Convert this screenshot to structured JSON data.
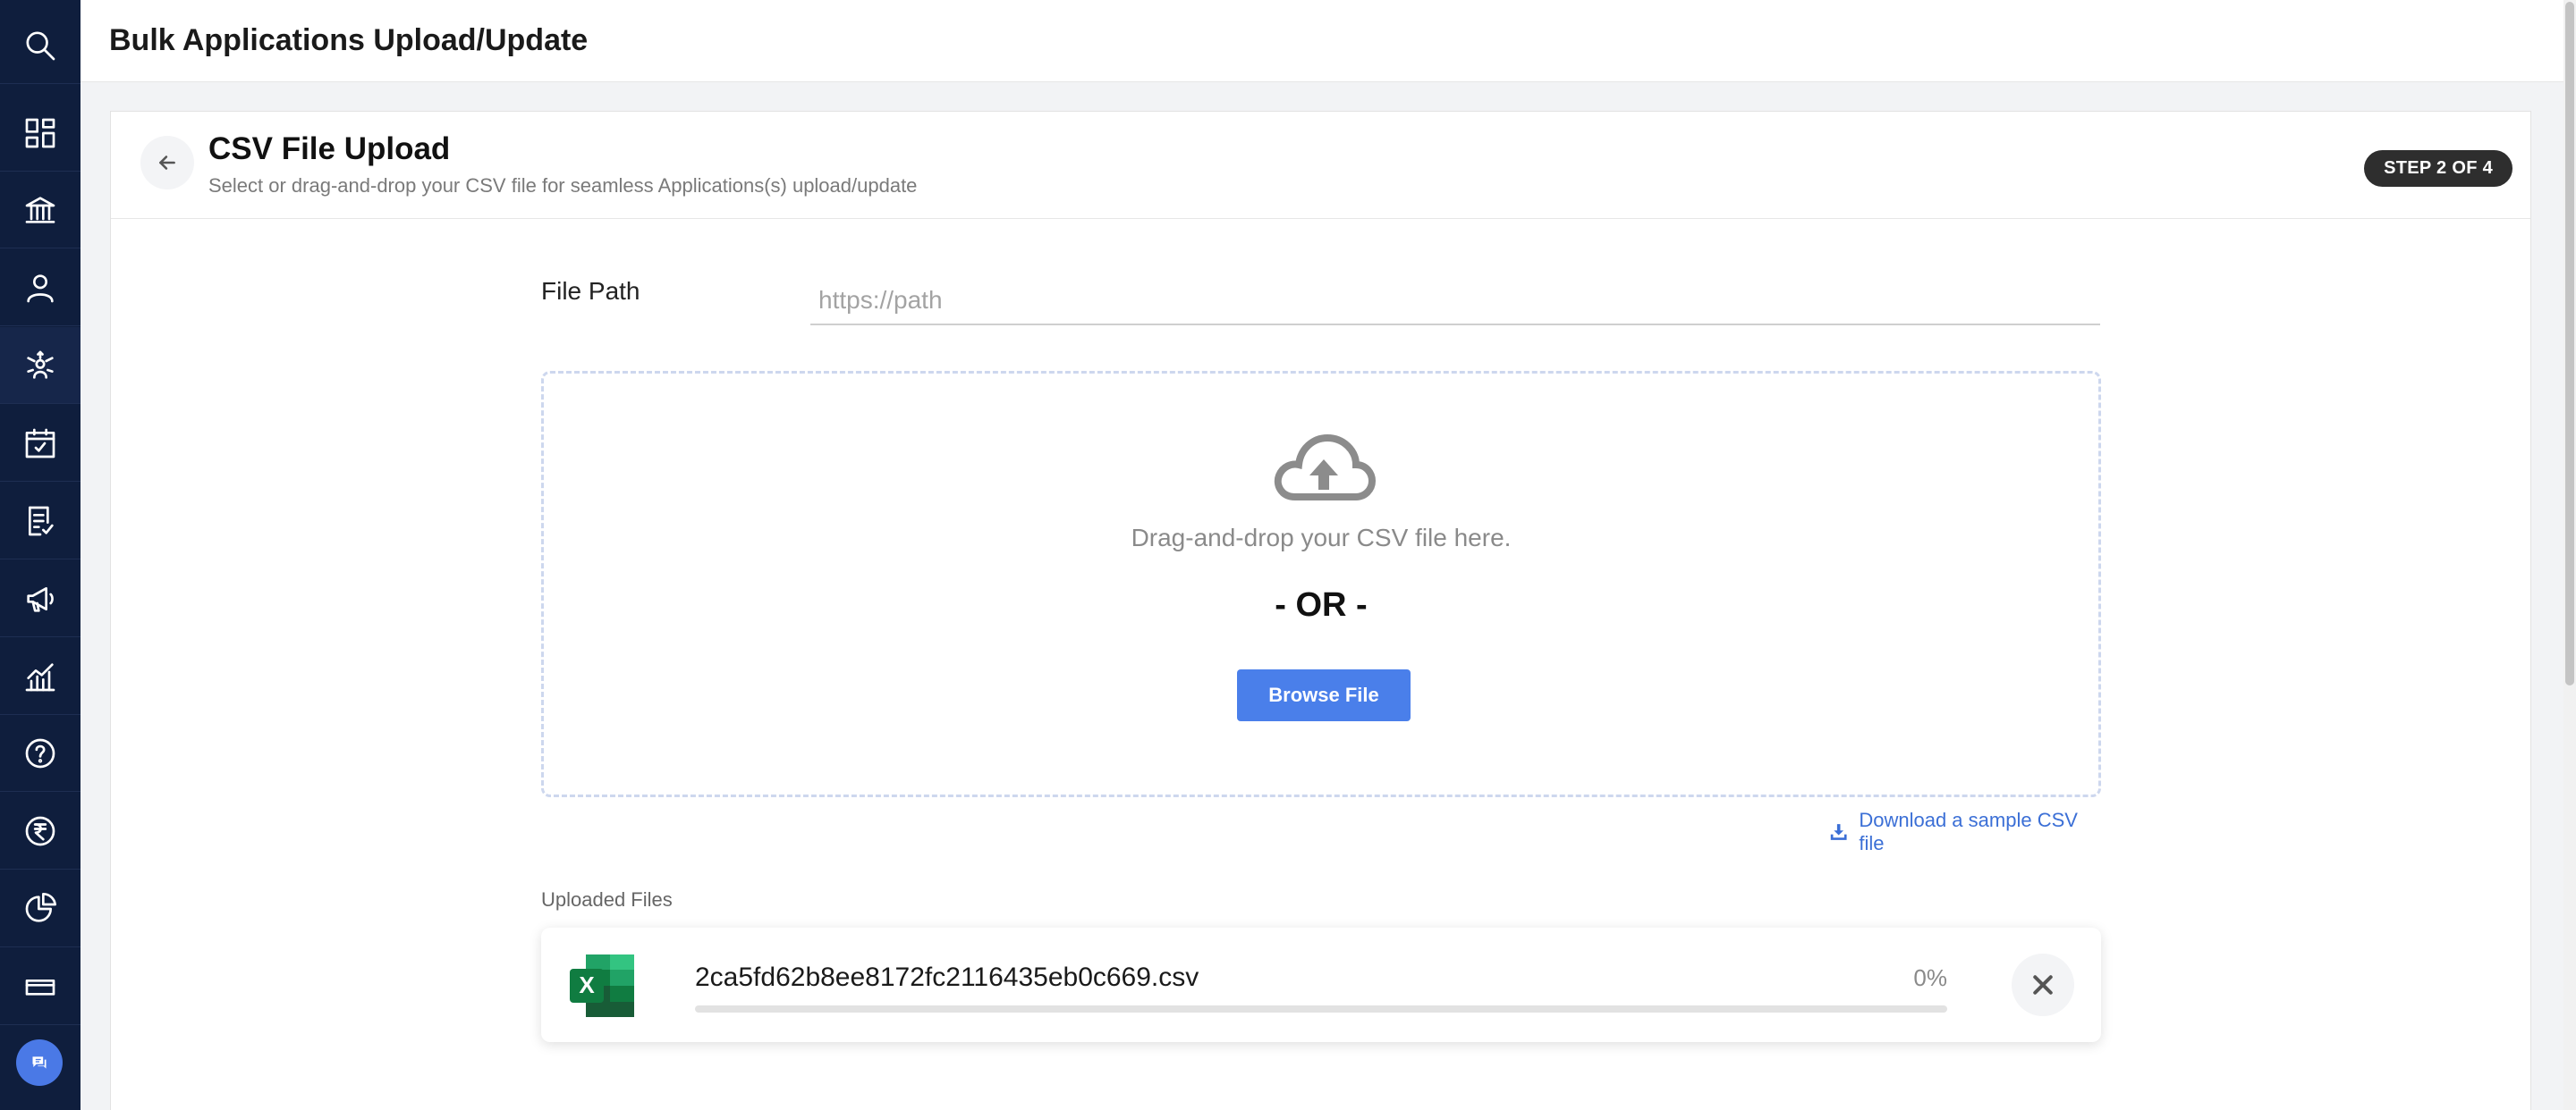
{
  "header": {
    "title": "Bulk Applications Upload/Update"
  },
  "sidebar": {
    "items": [
      {
        "icon": "search-icon"
      },
      {
        "icon": "dashboard-icon"
      },
      {
        "icon": "institution-icon"
      },
      {
        "icon": "user-icon"
      },
      {
        "icon": "network-icon"
      },
      {
        "icon": "calendar-check-icon"
      },
      {
        "icon": "document-check-icon"
      },
      {
        "icon": "megaphone-icon"
      },
      {
        "icon": "chart-icon"
      },
      {
        "icon": "help-icon"
      },
      {
        "icon": "rupee-icon"
      },
      {
        "icon": "pie-chart-icon"
      },
      {
        "icon": "card-icon"
      }
    ],
    "chat_icon": "chat-icon"
  },
  "card": {
    "title": "CSV File Upload",
    "subtitle": "Select or drag-and-drop your CSV file for seamless Applications(s) upload/update",
    "step": "STEP 2 OF 4"
  },
  "file_path": {
    "label": "File Path",
    "placeholder": "https://path",
    "value": ""
  },
  "dropzone": {
    "text": "Drag-and-drop your CSV file here.",
    "or_text": "- OR -",
    "browse_label": "Browse File"
  },
  "download_link": "Download a sample CSV file",
  "uploaded": {
    "label": "Uploaded Files",
    "files": [
      {
        "name": "2ca5fd62b8ee8172fc2116435eb0c669.csv",
        "progress_text": "0%",
        "progress": 0,
        "icon": "excel-icon"
      }
    ]
  },
  "colors": {
    "sidebar": "#0f1e3d",
    "accent": "#4a7fea",
    "badge": "#2e2e2e"
  }
}
